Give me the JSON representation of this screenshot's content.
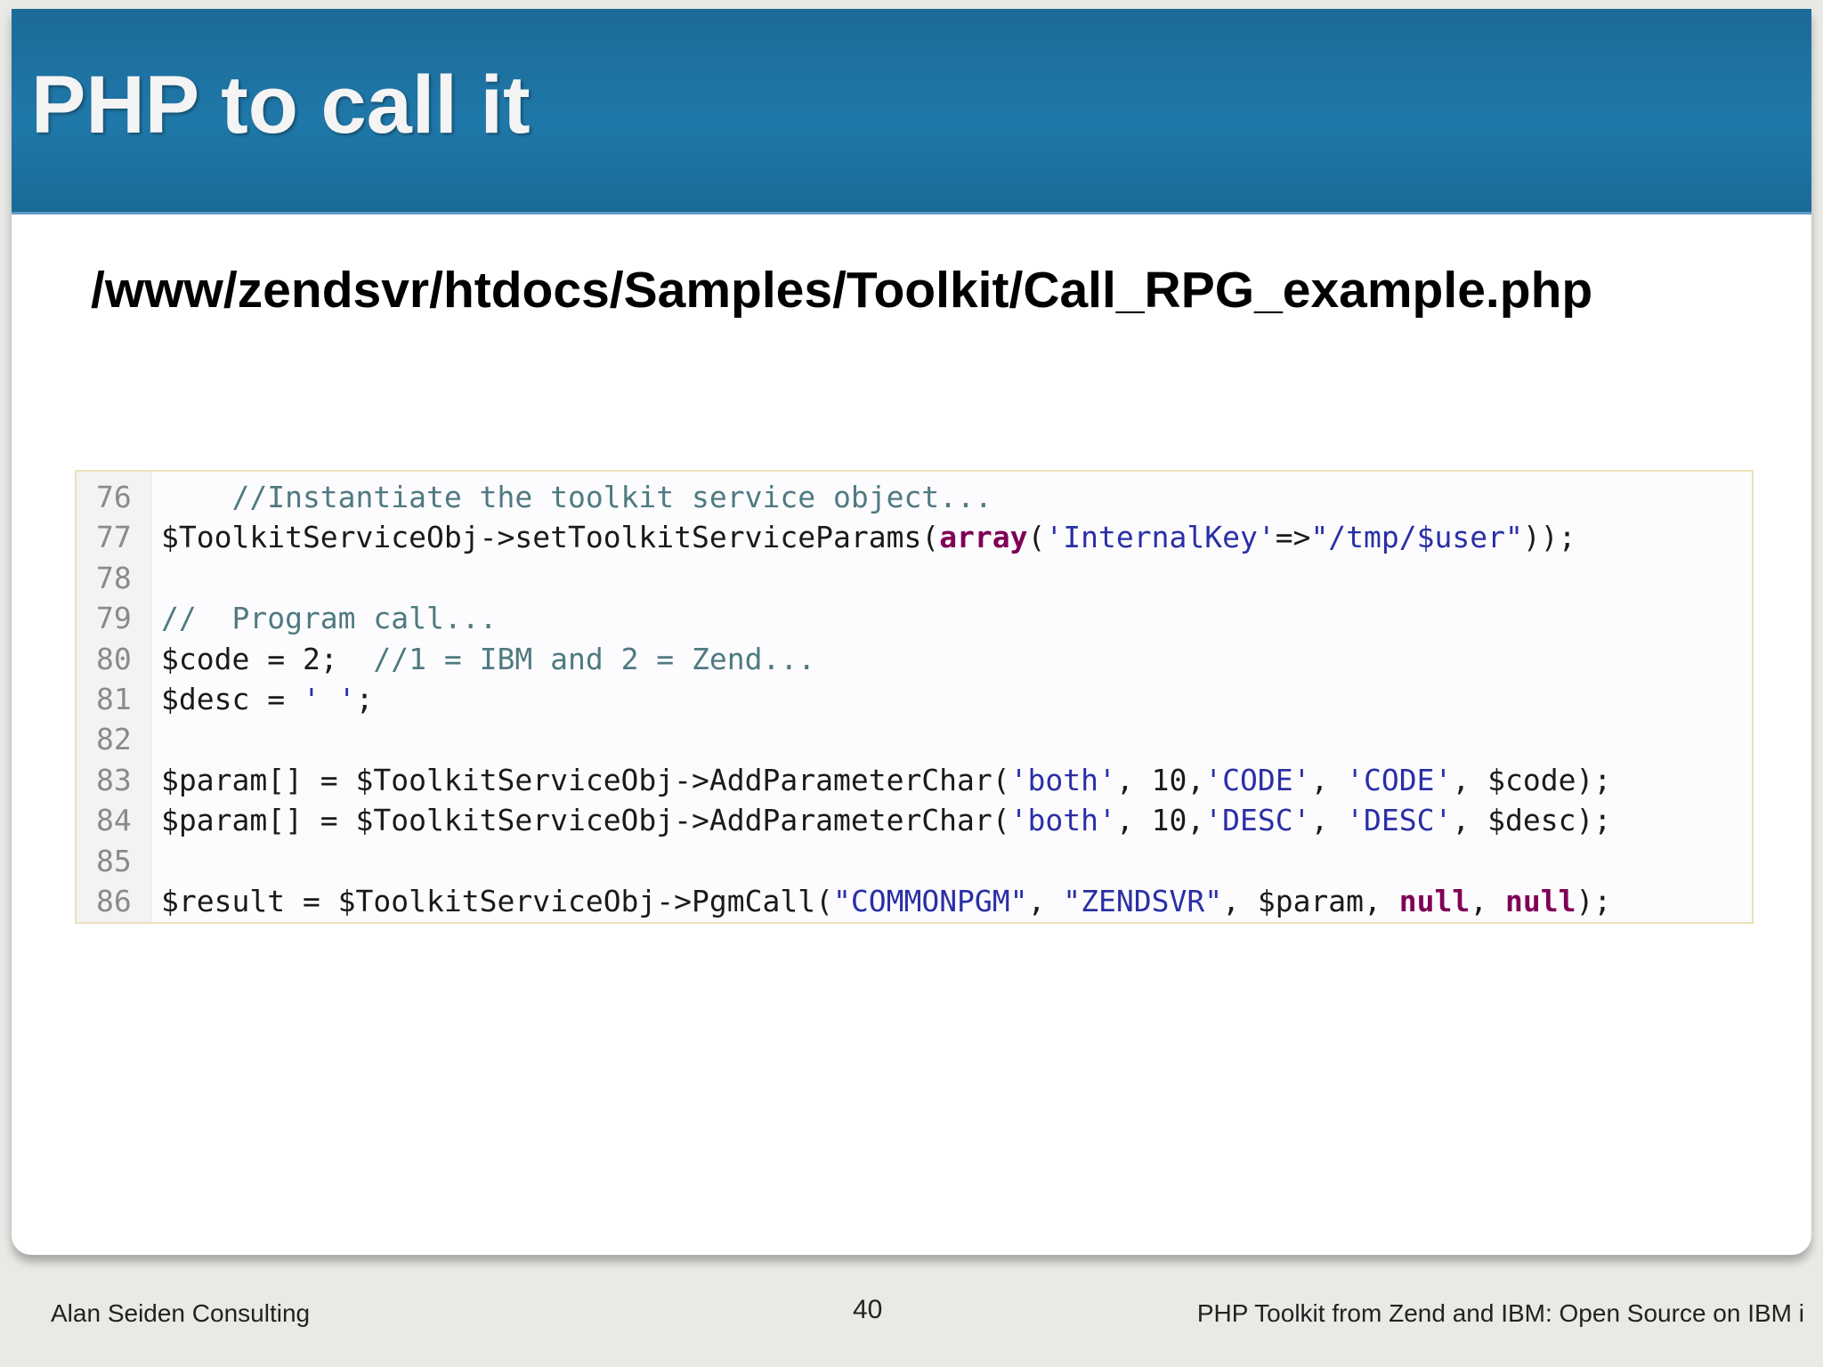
{
  "slide": {
    "title": "PHP to call it",
    "file_path": "/www/zendsvr/htdocs/Samples/Toolkit/Call_RPG_example.php"
  },
  "code": {
    "lines": [
      {
        "number": "76",
        "tokens": [
          {
            "text": "    //Instantiate the toolkit service object...",
            "kind": "comment"
          }
        ]
      },
      {
        "number": "77",
        "tokens": [
          {
            "text": "$ToolkitServiceObj->setToolkitServiceParams(",
            "kind": "plain"
          },
          {
            "text": "array",
            "kind": "keyword"
          },
          {
            "text": "(",
            "kind": "plain"
          },
          {
            "text": "'InternalKey'",
            "kind": "string"
          },
          {
            "text": "=>",
            "kind": "plain"
          },
          {
            "text": "\"/tmp/$user\"",
            "kind": "string"
          },
          {
            "text": "));",
            "kind": "plain"
          }
        ]
      },
      {
        "number": "78",
        "tokens": []
      },
      {
        "number": "79",
        "tokens": [
          {
            "text": "//  Program call...",
            "kind": "comment"
          }
        ]
      },
      {
        "number": "80",
        "tokens": [
          {
            "text": "$code = 2;  ",
            "kind": "plain"
          },
          {
            "text": "//1 = IBM and 2 = Zend...",
            "kind": "comment"
          }
        ]
      },
      {
        "number": "81",
        "tokens": [
          {
            "text": "$desc = ",
            "kind": "plain"
          },
          {
            "text": "' '",
            "kind": "string"
          },
          {
            "text": ";",
            "kind": "plain"
          }
        ]
      },
      {
        "number": "82",
        "tokens": []
      },
      {
        "number": "83",
        "tokens": [
          {
            "text": "$param[] = $ToolkitServiceObj->AddParameterChar(",
            "kind": "plain"
          },
          {
            "text": "'both'",
            "kind": "string"
          },
          {
            "text": ", 10,",
            "kind": "plain"
          },
          {
            "text": "'CODE'",
            "kind": "string"
          },
          {
            "text": ", ",
            "kind": "plain"
          },
          {
            "text": "'CODE'",
            "kind": "string"
          },
          {
            "text": ", $code);",
            "kind": "plain"
          }
        ]
      },
      {
        "number": "84",
        "tokens": [
          {
            "text": "$param[] = $ToolkitServiceObj->AddParameterChar(",
            "kind": "plain"
          },
          {
            "text": "'both'",
            "kind": "string"
          },
          {
            "text": ", 10,",
            "kind": "plain"
          },
          {
            "text": "'DESC'",
            "kind": "string"
          },
          {
            "text": ", ",
            "kind": "plain"
          },
          {
            "text": "'DESC'",
            "kind": "string"
          },
          {
            "text": ", $desc);",
            "kind": "plain"
          }
        ]
      },
      {
        "number": "85",
        "tokens": []
      },
      {
        "number": "86",
        "tokens": [
          {
            "text": "$result = $ToolkitServiceObj->PgmCall(",
            "kind": "plain"
          },
          {
            "text": "\"COMMONPGM\"",
            "kind": "string"
          },
          {
            "text": ", ",
            "kind": "plain"
          },
          {
            "text": "\"ZENDSVR\"",
            "kind": "string"
          },
          {
            "text": ", $param, ",
            "kind": "plain"
          },
          {
            "text": "null",
            "kind": "keyword"
          },
          {
            "text": ", ",
            "kind": "plain"
          },
          {
            "text": "null",
            "kind": "keyword"
          },
          {
            "text": ");",
            "kind": "plain"
          }
        ]
      }
    ]
  },
  "footer": {
    "left": "Alan Seiden Consulting",
    "page_number": "40",
    "right": "PHP Toolkit from Zend and IBM: Open Source on IBM i"
  },
  "colors": {
    "title_bar": "#1f78a9",
    "comment": "#4f7a80",
    "string": "#2a2fa5",
    "keyword": "#7f0055"
  }
}
